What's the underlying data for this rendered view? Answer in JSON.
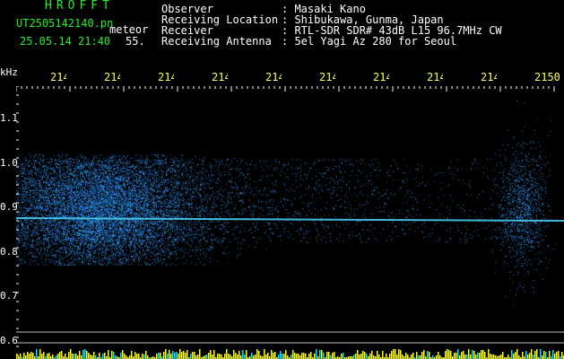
{
  "header": {
    "brand": "HROFFT",
    "filename": "UT2505142140.pn",
    "filename_suffix": "meteor",
    "timestamp": "25.05.14 21:40",
    "count": "55."
  },
  "metadata": [
    {
      "label": "Observer",
      "value": ": Masaki Kano"
    },
    {
      "label": "Receiving Location",
      "value": ": Shibukawa, Gunma, Japan"
    },
    {
      "label": "Receiver",
      "value": ": RTL-SDR SDR# 43dB L15 96.7MHz CW"
    },
    {
      "label": "Receiving Antenna",
      "value": ": 5el Yagi Az 280 for Seoul"
    }
  ],
  "axes": {
    "unit": "kHz",
    "y_ticks": [
      "1.1",
      "1.0",
      "0.9",
      "0.8",
      "0.7",
      "0.6"
    ],
    "x_ticks": [
      "214",
      "214",
      "214",
      "214",
      "214",
      "214",
      "214",
      "214",
      "214",
      "2150"
    ]
  },
  "colors": {
    "header_green": "#22ee22",
    "header_white": "#ffffff",
    "tick_yellow": "#ffff55",
    "signal_blue": "#2f6cff",
    "carrier_cyan": "#4fd8ff",
    "bottom_bar_yellow": "#ffff00",
    "bottom_bar_cyan": "#00e5ff"
  }
}
